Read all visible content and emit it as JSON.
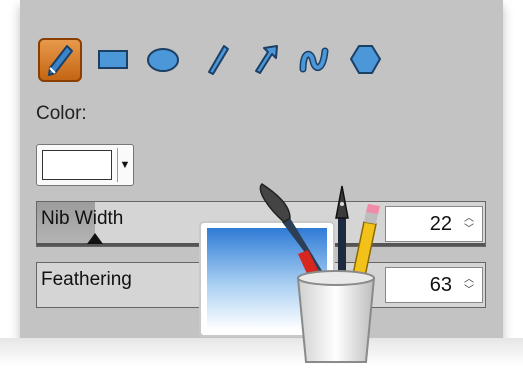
{
  "tools": [
    {
      "name": "pen",
      "selected": true
    },
    {
      "name": "rectangle",
      "selected": false
    },
    {
      "name": "ellipse",
      "selected": false
    },
    {
      "name": "line",
      "selected": false
    },
    {
      "name": "arrow",
      "selected": false
    },
    {
      "name": "curve",
      "selected": false
    },
    {
      "name": "polygon",
      "selected": false
    }
  ],
  "color_label": "Color:",
  "color_value": "#ffffff",
  "nib_width": {
    "label": "Nib Width",
    "value": "22",
    "slider_fraction": 0.13
  },
  "feathering": {
    "label": "Feathering",
    "value": "63"
  },
  "colors": {
    "panel": "#c3c3c3",
    "selected_tool": "#d57a2a",
    "tool_blue": "#3a84c9"
  }
}
